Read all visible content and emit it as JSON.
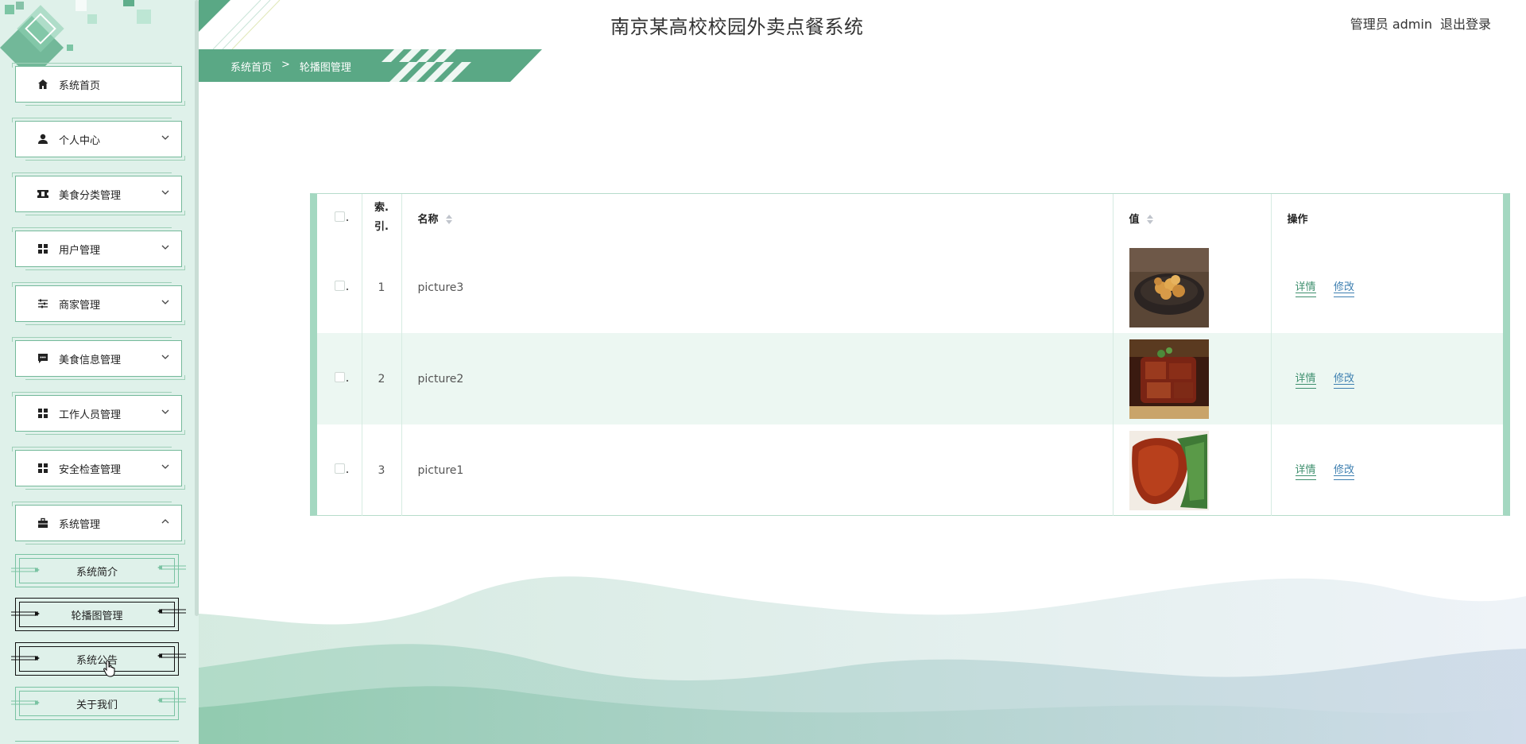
{
  "app_title": "南京某高校校园外卖点餐系统",
  "user": {
    "role_name": "管理员 admin",
    "logout_label": "退出登录"
  },
  "breadcrumb": {
    "home": "系统首页",
    "separator": ">",
    "current": "轮播图管理"
  },
  "sidebar": {
    "items": [
      {
        "label": "系统首页",
        "icon": "home-icon",
        "expandable": false
      },
      {
        "label": "个人中心",
        "icon": "user-icon",
        "expandable": true
      },
      {
        "label": "美食分类管理",
        "icon": "ticket-icon",
        "expandable": true
      },
      {
        "label": "用户管理",
        "icon": "grid-icon",
        "expandable": true
      },
      {
        "label": "商家管理",
        "icon": "sliders-icon",
        "expandable": true
      },
      {
        "label": "美食信息管理",
        "icon": "message-icon",
        "expandable": true
      },
      {
        "label": "工作人员管理",
        "icon": "grid-icon",
        "expandable": true
      },
      {
        "label": "安全检查管理",
        "icon": "grid-icon",
        "expandable": true
      },
      {
        "label": "系统管理",
        "icon": "briefcase-icon",
        "expandable": true,
        "expanded": true
      }
    ],
    "sub_items": [
      {
        "label": "系统简介",
        "active": false
      },
      {
        "label": "轮播图管理",
        "active": true
      },
      {
        "label": "系统公告",
        "active": true
      },
      {
        "label": "关于我们",
        "active": false
      }
    ]
  },
  "table": {
    "headers": {
      "index": "索.\n引.",
      "name": "名称",
      "value": "值",
      "actions": "操作"
    },
    "rows": [
      {
        "index": "1",
        "name": "picture3",
        "image": "fried-chicken-image"
      },
      {
        "index": "2",
        "name": "picture2",
        "image": "braised-pork-image"
      },
      {
        "index": "3",
        "name": "picture1",
        "image": "roast-meat-image"
      }
    ],
    "actions": {
      "detail": "详情",
      "edit": "修改"
    }
  },
  "colors": {
    "primary": "#5aa885",
    "sidebar_bg": "#dff1ea",
    "row_stripe": "#ecf7f2",
    "detail_link": "#3e8f6e",
    "edit_link": "#3d7fb0"
  }
}
